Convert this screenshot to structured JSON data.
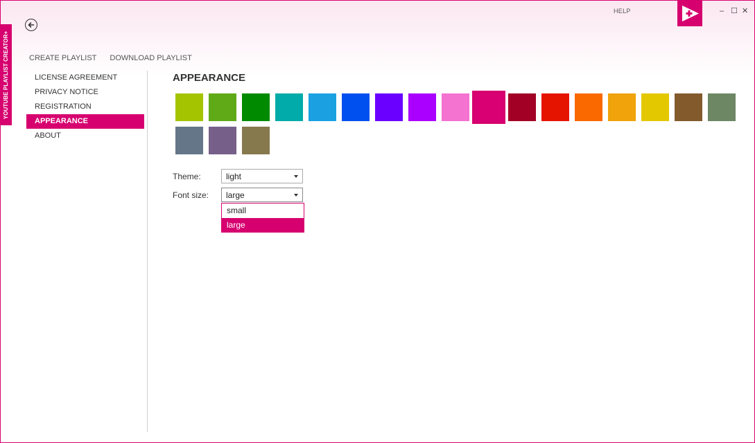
{
  "app": {
    "side_title": "YOUTUBE PLAYLIST CREATOR+",
    "help_label": "HELP"
  },
  "icons": {
    "back": "back-arrow-icon",
    "logo": "play-plus-logo",
    "minimize": "–",
    "maximize": "☐",
    "close": "✕"
  },
  "topnav": {
    "create": "CREATE PLAYLIST",
    "download": "DOWNLOAD PLAYLIST"
  },
  "leftnav": {
    "items": [
      {
        "label": "LICENSE AGREEMENT",
        "active": false
      },
      {
        "label": "PRIVACY NOTICE",
        "active": false
      },
      {
        "label": "REGISTRATION",
        "active": false
      },
      {
        "label": "APPEARANCE",
        "active": true
      },
      {
        "label": "ABOUT",
        "active": false
      }
    ]
  },
  "appearance": {
    "title": "APPEARANCE",
    "accent_color": "#d6006f",
    "selected_index": 9,
    "swatches": [
      "#a4c400",
      "#60a917",
      "#008a00",
      "#00aba9",
      "#1ba1e2",
      "#0050ef",
      "#6a00ff",
      "#aa00ff",
      "#f472d0",
      "#d80073",
      "#a20025",
      "#e51400",
      "#fa6800",
      "#f0a30a",
      "#e3c800",
      "#825a2c",
      "#6d8764",
      "#647687",
      "#76608a",
      "#87794e"
    ],
    "theme_label": "Theme:",
    "theme_value": "light",
    "font_label": "Font size:",
    "font_value": "large",
    "font_options": [
      "small",
      "large"
    ],
    "font_selected": "large"
  }
}
